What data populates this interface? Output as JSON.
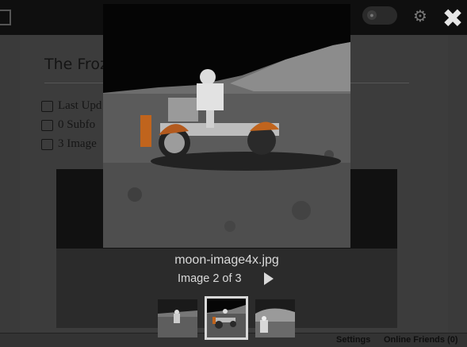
{
  "lightbox": {
    "filename": "moon-image4x.jpg",
    "counter": "Image 2 of 3",
    "thumbnails": [
      "thumbnail-1",
      "thumbnail-2",
      "thumbnail-3"
    ],
    "active_thumbnail": 2
  },
  "background_page": {
    "title": "The Froz",
    "meta": {
      "updated": "Last Upd",
      "subfolders": "0 Subfo",
      "images": "3 Image"
    }
  },
  "status_bar": {
    "settings": "Settings",
    "online_friends": "Online Friends (0)"
  },
  "colors": {
    "overlay": "#1b1b1b",
    "caption_text": "#d9d9d9",
    "active_thumb_border": "#d8d8d8"
  },
  "icons": [
    "close-icon",
    "next-arrow-icon",
    "gear-icon",
    "eye-icon",
    "calendar-icon",
    "folder-icon",
    "images-icon"
  ]
}
